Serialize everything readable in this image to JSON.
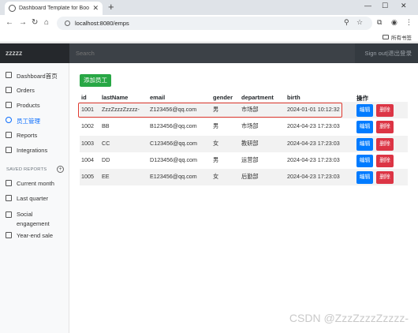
{
  "browser": {
    "tab_title": "Dashboard Template for Boo",
    "url": "localhost:8080/emps",
    "bookmarks_label": "所有书签"
  },
  "navbar": {
    "brand": "zzzzz",
    "search_placeholder": "Search",
    "signout": "Sign out|退出登录"
  },
  "sidebar": {
    "items": [
      {
        "label": "Dashboard首页",
        "icon": "home-icon"
      },
      {
        "label": "Orders",
        "icon": "file-icon"
      },
      {
        "label": "Products",
        "icon": "cart-icon"
      },
      {
        "label": "员工管理",
        "icon": "users-icon"
      },
      {
        "label": "Reports",
        "icon": "bar-chart-icon"
      },
      {
        "label": "Integrations",
        "icon": "layers-icon"
      }
    ],
    "saved_reports_heading": "SAVED REPORTS",
    "reports": [
      {
        "label": "Current month"
      },
      {
        "label": "Last quarter"
      },
      {
        "label": "Social engagement"
      },
      {
        "label": "Year-end sale"
      }
    ]
  },
  "main": {
    "add_button": "添加员工",
    "columns": [
      "id",
      "lastName",
      "email",
      "gender",
      "department",
      "birth",
      "操作"
    ],
    "rows": [
      {
        "id": "1001",
        "lastName": "ZzzZzzzZzzzz-",
        "email": "Z123456@qq.com",
        "gender": "男",
        "department": "市场部",
        "birth": "2024-01-01 10:12:32"
      },
      {
        "id": "1002",
        "lastName": "BB",
        "email": "B123456@qq.com",
        "gender": "男",
        "department": "市场部",
        "birth": "2024-04-23 17:23:03"
      },
      {
        "id": "1003",
        "lastName": "CC",
        "email": "C123456@qq.com",
        "gender": "女",
        "department": "教研部",
        "birth": "2024-04-23 17:23:03"
      },
      {
        "id": "1004",
        "lastName": "DD",
        "email": "D123456@qq.com",
        "gender": "男",
        "department": "运营部",
        "birth": "2024-04-23 17:23:03"
      },
      {
        "id": "1005",
        "lastName": "EE",
        "email": "E123456@qq.com",
        "gender": "女",
        "department": "后勤部",
        "birth": "2024-04-23 17:23:03"
      }
    ],
    "edit_label": "编辑",
    "delete_label": "删除"
  },
  "watermark": "CSDN @ZzzZzzzZzzzz-",
  "colors": {
    "add": "#28a745",
    "edit": "#007bff",
    "delete": "#dc3545",
    "highlight": "#e0392f"
  }
}
